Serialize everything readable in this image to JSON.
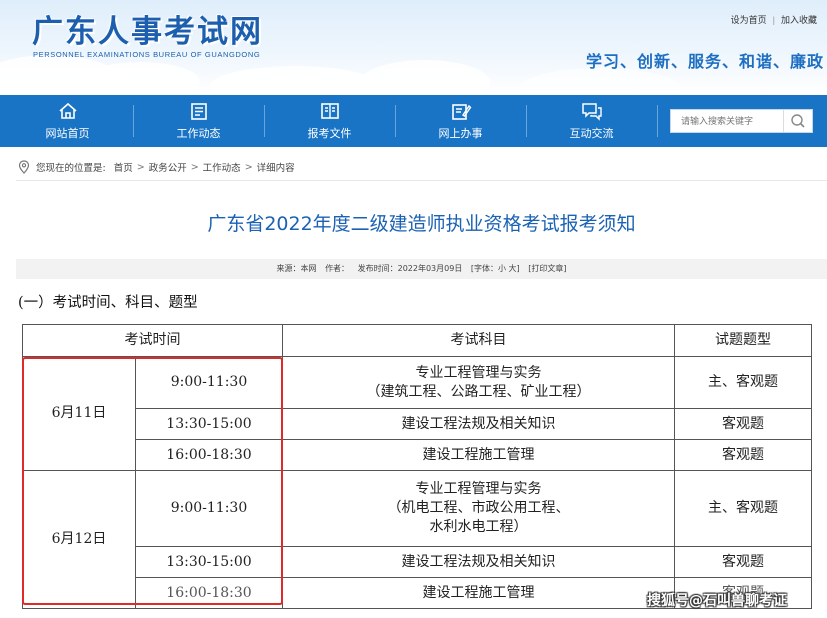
{
  "header": {
    "title": "广东人事考试网",
    "subtitle_en": "PERSONNEL EXAMINATIONS BUREAU OF GUANGDONG",
    "links": [
      "设为首页",
      "加入收藏"
    ],
    "slogan": "学习、创新、服务、和谐、廉政"
  },
  "nav": {
    "items": [
      {
        "label": "网站首页",
        "icon": "home-icon"
      },
      {
        "label": "工作动态",
        "icon": "news-icon"
      },
      {
        "label": "报考文件",
        "icon": "document-icon"
      },
      {
        "label": "网上办事",
        "icon": "edit-icon"
      },
      {
        "label": "互动交流",
        "icon": "chat-icon"
      }
    ],
    "search_placeholder": "请输入搜索关键字"
  },
  "breadcrumb": {
    "prefix": "您现在的位置是:",
    "items": [
      "首页",
      "政务公开",
      "工作动态",
      "详细内容"
    ],
    "separator": ">"
  },
  "article": {
    "title": "广东省2022年度二级建造师执业资格考试报考须知",
    "meta": {
      "source": "来源：本网",
      "author": "作者：",
      "date": "发布时间：2022年03月09日",
      "font": "[字体：小 大]",
      "print": "[打印文章]"
    },
    "section_heading": "(一）考试时间、科目、题型"
  },
  "table": {
    "headers": [
      "考试时间",
      "考试科目",
      "试题题型"
    ],
    "days": [
      {
        "date": "6月11日",
        "sessions": [
          {
            "time": "9:00-11:30",
            "subject": [
              "专业工程管理与实务",
              "（建筑工程、公路工程、矿业工程）"
            ],
            "type": "主、客观题"
          },
          {
            "time": "13:30-15:00",
            "subject": [
              "建设工程法规及相关知识"
            ],
            "type": "客观题"
          },
          {
            "time": "16:00-18:30",
            "subject": [
              "建设工程施工管理"
            ],
            "type": "客观题"
          }
        ]
      },
      {
        "date": "6月12日",
        "sessions": [
          {
            "time": "9:00-11:30",
            "subject": [
              "专业工程管理与实务",
              "（机电工程、市政公用工程、",
              "水利水电工程）"
            ],
            "type": "主、客观题"
          },
          {
            "time": "13:30-15:00",
            "subject": [
              "建设工程法规及相关知识"
            ],
            "type": "客观题"
          },
          {
            "time": "16:00-18:30",
            "subject": [
              "建设工程施工管理"
            ],
            "type": "客观题"
          }
        ]
      }
    ]
  },
  "watermark": "搜狐号@石叫兽聊考证",
  "colors": {
    "nav_bg": "#1a74c6",
    "title_blue": "#1b62b4",
    "highlight_red": "#e02a2a"
  }
}
